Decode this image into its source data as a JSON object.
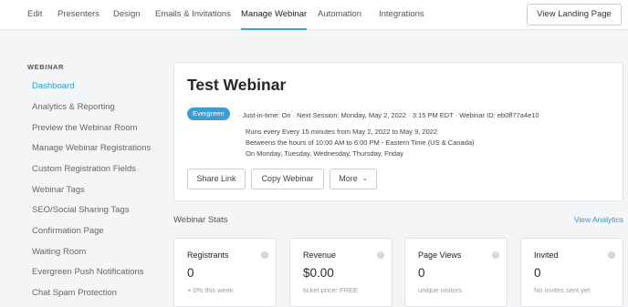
{
  "topnav": {
    "tabs": [
      "Edit",
      "Presenters",
      "Design",
      "Emails & Invitations",
      "Manage Webinar",
      "Automation",
      "Integrations"
    ],
    "active_tab": "Manage Webinar",
    "landing_button": "View Landing Page"
  },
  "sidebar": {
    "heading": "WEBINAR",
    "items": [
      "Dashboard",
      "Analytics & Reporting",
      "Preview the Webinar Room",
      "Manage Webinar Registrations",
      "Custom Registration Fields",
      "Webinar Tags",
      "SEO/Social Sharing Tags",
      "Confirmation Page",
      "Waiting Room",
      "Evergreen Push Notifications",
      "Chat Spam Protection"
    ],
    "active_item": "Dashboard"
  },
  "webinar": {
    "title": "Test Webinar",
    "badge": "Evergreen",
    "meta": "· Just-in-time: On · Next Session: Monday, May 2, 2022 · 3:15 PM EDT · Webinar ID: eb0ff77a4e10",
    "schedule": [
      "Runs every Every 15 minutes from May 2, 2022 to May 9, 2022",
      "Betweens the hours of 10:00 AM to 6:00 PM - Eastern Time (US & Canada)",
      "On Monday, Tuesday, Wednesday, Thursday, Friday"
    ],
    "buttons": {
      "share": "Share Link",
      "copy": "Copy Webinar",
      "more": "More"
    }
  },
  "stats": {
    "heading": "Webinar Stats",
    "view_link": "View Analytics",
    "cards": [
      {
        "label": "Registrants",
        "value": "0",
        "sub": "+ 0% this week"
      },
      {
        "label": "Revenue",
        "value": "$0.00",
        "sub": "ticket price: FREE"
      },
      {
        "label": "Page Views",
        "value": "0",
        "sub": "unique visitors"
      },
      {
        "label": "Invited",
        "value": "0",
        "sub": "No invites sent yet"
      }
    ]
  },
  "colors": {
    "accent": "#2a9bd0",
    "badge": "#3a9ed4"
  }
}
